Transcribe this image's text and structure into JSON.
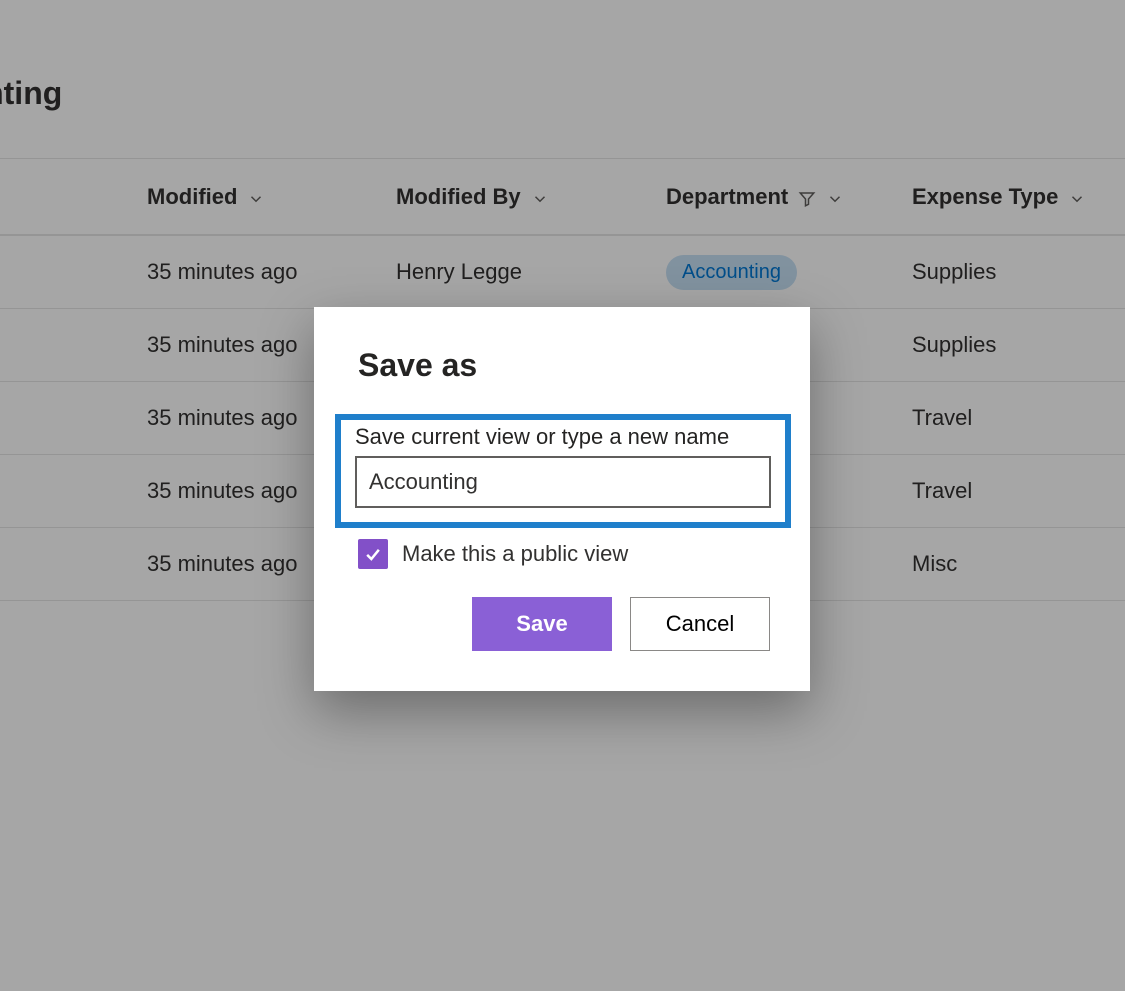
{
  "page": {
    "title": "ounting"
  },
  "columns": {
    "modified": "Modified",
    "modifiedby": "Modified By",
    "department": "Department",
    "expensetype": "Expense Type"
  },
  "rows": [
    {
      "modified": "35 minutes ago",
      "modifiedby": "Henry Legge",
      "dept": "Accounting",
      "type": "Supplies"
    },
    {
      "modified": "35 minutes ago",
      "modifiedby": "",
      "dept": "",
      "type": "Supplies"
    },
    {
      "modified": "35 minutes ago",
      "modifiedby": "",
      "dept": "",
      "type": "Travel"
    },
    {
      "modified": "35 minutes ago",
      "modifiedby": "",
      "dept": "",
      "type": "Travel"
    },
    {
      "modified": "35 minutes ago",
      "modifiedby": "",
      "dept": "",
      "type": "Misc"
    }
  ],
  "dialog": {
    "title": "Save as",
    "field_label": "Save current view or type a new name",
    "input_value": "Accounting",
    "public_label": "Make this a public view",
    "public_checked": true,
    "save_label": "Save",
    "cancel_label": "Cancel"
  },
  "colors": {
    "accent": "#8250c8",
    "highlight_border": "#1f7fcb",
    "chip_bg": "#c7e0f4",
    "chip_fg": "#0078d4"
  }
}
